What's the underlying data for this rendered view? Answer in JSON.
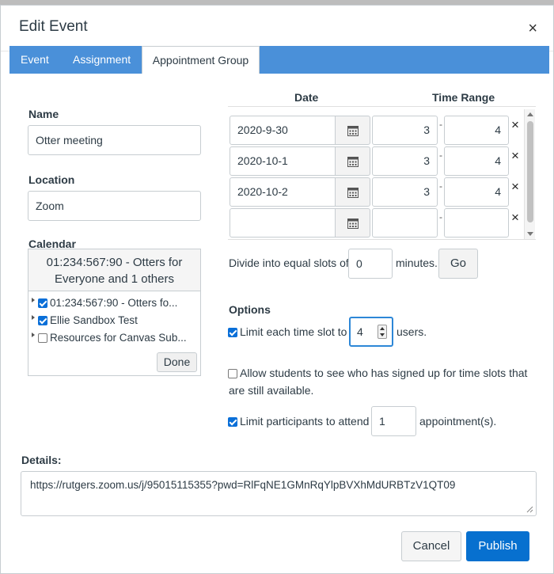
{
  "dialog": {
    "title": "Edit Event",
    "close_icon": "close-icon"
  },
  "tabs": [
    {
      "label": "Event"
    },
    {
      "label": "Assignment"
    },
    {
      "label": "Appointment Group",
      "active": true
    }
  ],
  "name": {
    "label": "Name",
    "value": "Otter meeting"
  },
  "location": {
    "label": "Location",
    "value": "Zoom"
  },
  "calendar": {
    "label": "Calendar",
    "selected_summary": "01:234:567:90 - Otters for Everyone and 1 others",
    "items": [
      {
        "label": "01:234:567:90 - Otters fo...",
        "checked": true
      },
      {
        "label": "Ellie Sandbox Test",
        "checked": true
      },
      {
        "label": "Resources for Canvas Sub...",
        "checked": false
      }
    ],
    "done_label": "Done"
  },
  "time_slots": {
    "date_header": "Date",
    "time_range_header": "Time Range",
    "rows": [
      {
        "date": "2020-9-30",
        "start": "3",
        "end": "4"
      },
      {
        "date": "2020-10-1",
        "start": "3",
        "end": "4"
      },
      {
        "date": "2020-10-2",
        "start": "3",
        "end": "4"
      },
      {
        "date": "",
        "start": "",
        "end": ""
      }
    ],
    "separator": "-",
    "remove_glyph": "×"
  },
  "divide": {
    "prefix": "Divide into equal slots of",
    "value": "0",
    "suffix": "minutes.",
    "go_label": "Go"
  },
  "options": {
    "heading": "Options",
    "limit_slot": {
      "checked": true,
      "label": "Limit each time slot to",
      "value": "4",
      "suffix": "users."
    },
    "allow_students": {
      "checked": false,
      "label_line1": "Allow students to see who has signed up for time slots that",
      "label_line2": "are still available."
    },
    "limit_participants": {
      "checked": true,
      "label": "Limit participants to attend",
      "value": "1",
      "suffix": "appointment(s)."
    }
  },
  "details": {
    "label": "Details:",
    "value": "https://rutgers.zoom.us/j/95015115355?pwd=RlFqNE1GMnRqYlpBVXhMdURBTzV1QT09"
  },
  "footer": {
    "cancel_label": "Cancel",
    "publish_label": "Publish"
  },
  "colors": {
    "accent": "#0770cf",
    "tab_bar": "#4a90d9",
    "checkbox": "#0a6fd8"
  }
}
